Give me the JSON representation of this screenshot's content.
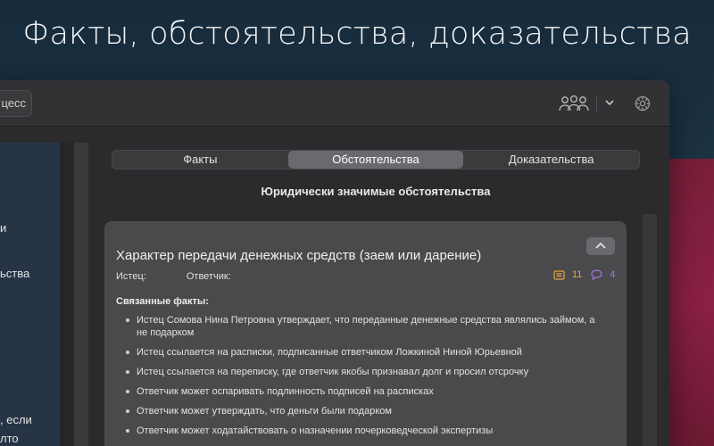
{
  "headline": "Факты, обстоятельства, доказательства",
  "toolbar": {
    "process_label": "цесс"
  },
  "sidebar": {
    "fragments": [
      "и",
      "ьства",
      ", если",
      "лто"
    ]
  },
  "tabs": [
    {
      "label": "Факты",
      "active": false
    },
    {
      "label": "Обстоятельства",
      "active": true
    },
    {
      "label": "Доказательства",
      "active": false
    }
  ],
  "section_title": "Юридически значимые обстоятельства",
  "card": {
    "title": "Характер передачи денежных средств (заем или дарение)",
    "plaintiff_label": "Истец:",
    "defendant_label": "Ответчик:",
    "notes_count": "11",
    "comments_count": "4",
    "related_label": "Связанные факты:",
    "facts": [
      "Истец Сомова Нина Петровна утверждает, что переданные денежные средства являлись займом, а не подарком",
      "Истец ссылается на расписки, подписанные ответчиком Ложкиной Ниной Юрьевной",
      "Истец ссылается на переписку, где ответчик якобы признавал долг и просил отсрочку",
      "Ответчик может оспаривать подлинность подписей на расписках",
      "Ответчик может утверждать, что деньги были подарком",
      "Ответчик может ходатайствовать о назначении почерковедческой экспертизы"
    ]
  },
  "colors": {
    "notes_accent": "#e6a23c",
    "comments_accent": "#a678e8"
  }
}
